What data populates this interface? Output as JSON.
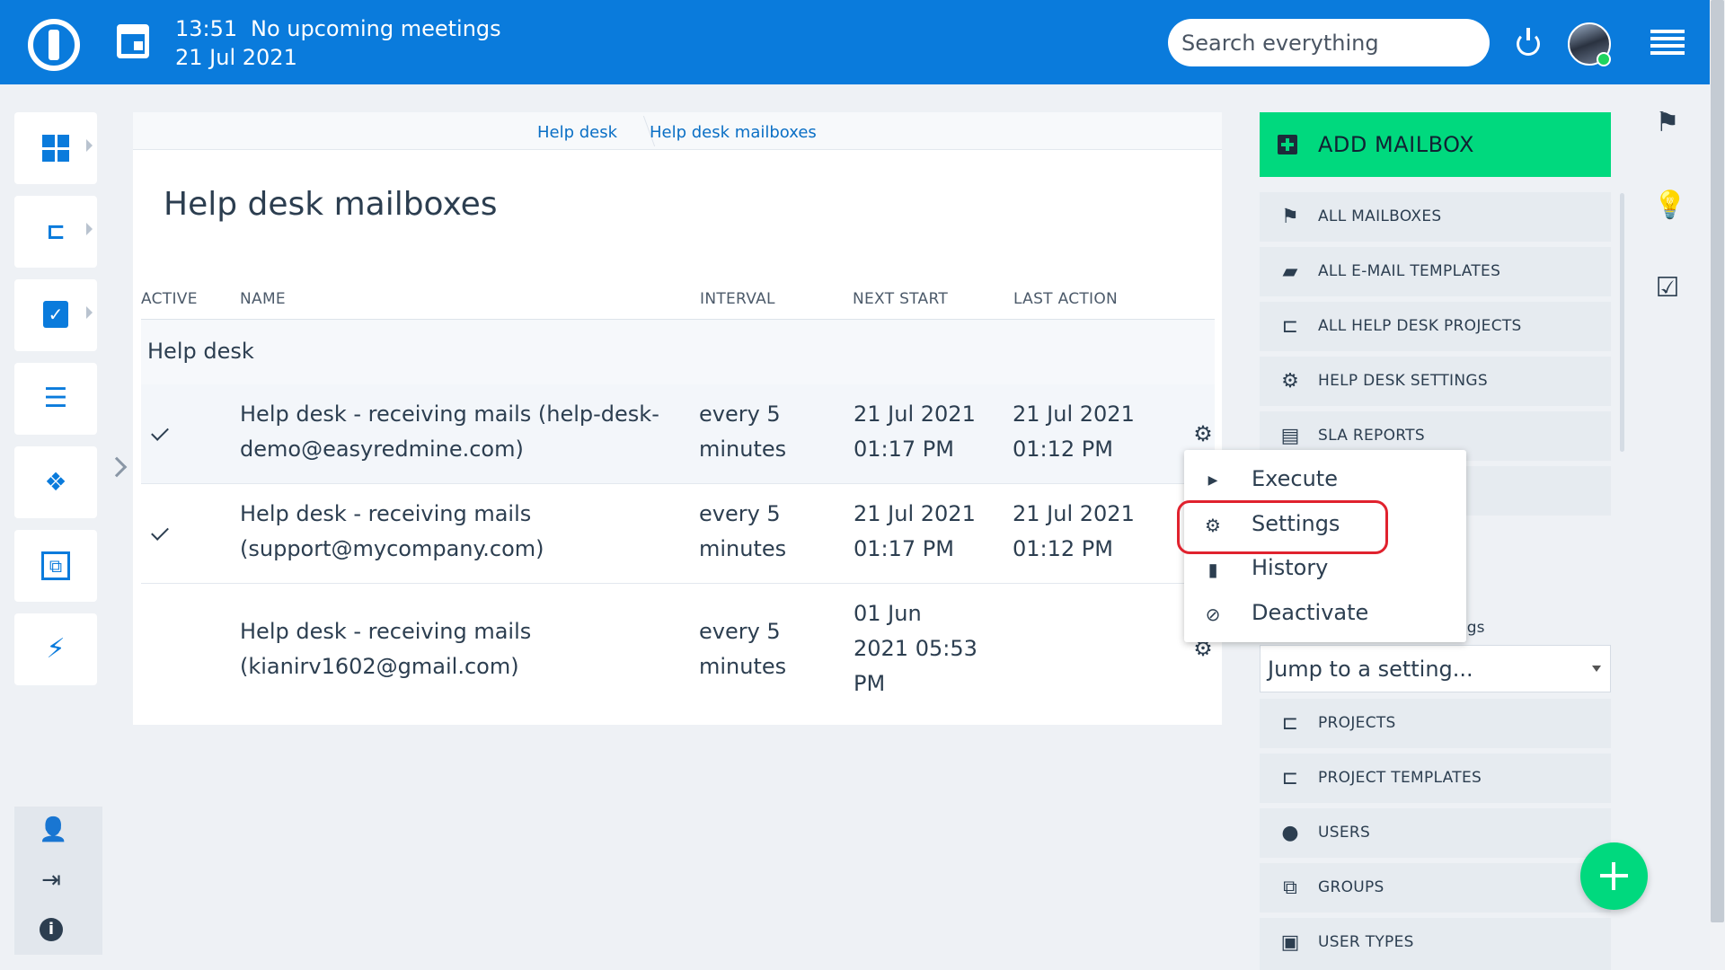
{
  "topbar": {
    "time": "13:51",
    "meetings": "No upcoming meetings",
    "date": "21 Jul 2021",
    "search_placeholder": "Search everything"
  },
  "breadcrumb": [
    "Help desk",
    "Help desk mailboxes"
  ],
  "page_title": "Help desk mailboxes",
  "table": {
    "headers": [
      "ACTIVE",
      "NAME",
      "INTERVAL",
      "NEXT START",
      "LAST ACTION"
    ],
    "group": "Help desk",
    "rows": [
      {
        "active": true,
        "name_1": "Help desk - receiving mails (help-desk-",
        "name_2": "demo@easyredmine.com)",
        "interval_1": "every 5",
        "interval_2": "minutes",
        "next_1": "21 Jul 2021",
        "next_2": "01:17 PM",
        "next_3": "",
        "last_1": "21 Jul 2021",
        "last_2": "01:12 PM"
      },
      {
        "active": true,
        "name_1": "Help desk - receiving mails",
        "name_2": "(support@mycompany.com)",
        "interval_1": "every 5",
        "interval_2": "minutes",
        "next_1": "21 Jul 2021",
        "next_2": "01:17 PM",
        "next_3": "",
        "last_1": "21 Jul 2021",
        "last_2": "01:12 PM"
      },
      {
        "active": false,
        "name_1": "Help desk - receiving mails",
        "name_2": "(kianirv1602@gmail.com)",
        "interval_1": "every 5",
        "interval_2": "minutes",
        "next_1": "01 Jun",
        "next_2": "2021 05:53",
        "next_3": "PM",
        "last_1": "",
        "last_2": ""
      }
    ]
  },
  "context_menu": {
    "items": [
      {
        "label": "Execute",
        "icon": "play-icon"
      },
      {
        "label": "Settings",
        "icon": "gear-icon"
      },
      {
        "label": "History",
        "icon": "bar-chart-icon"
      },
      {
        "label": "Deactivate",
        "icon": "block-icon"
      }
    ],
    "highlight_color": "#e0222e"
  },
  "right_sidebar": {
    "add_button": "ADD MAILBOX",
    "nav": [
      {
        "label": "ALL MAILBOXES",
        "icon": "flag-icon"
      },
      {
        "label": "ALL E-MAIL TEMPLATES",
        "icon": "chat-icon"
      },
      {
        "label": "ALL HELP DESK PROJECTS",
        "icon": "project-tree-icon"
      },
      {
        "label": "HELP DESK SETTINGS",
        "icon": "gear-icon"
      },
      {
        "label": "SLA REPORTS",
        "icon": "clipboard-icon"
      }
    ],
    "jump_label_partial": "ngs",
    "jump_placeholder": "Jump to a setting...",
    "settings_nav": [
      {
        "label": "PROJECTS",
        "icon": "project-tree-icon"
      },
      {
        "label": "PROJECT TEMPLATES",
        "icon": "project-tree-icon"
      },
      {
        "label": "USERS",
        "icon": "user-icon"
      },
      {
        "label": "GROUPS",
        "icon": "group-icon"
      },
      {
        "label": "USER TYPES",
        "icon": "user-badge-icon"
      }
    ]
  },
  "colors": {
    "topbar": "#0a7bdc",
    "accent_green": "#00d97e",
    "link": "#0a6fc5"
  }
}
